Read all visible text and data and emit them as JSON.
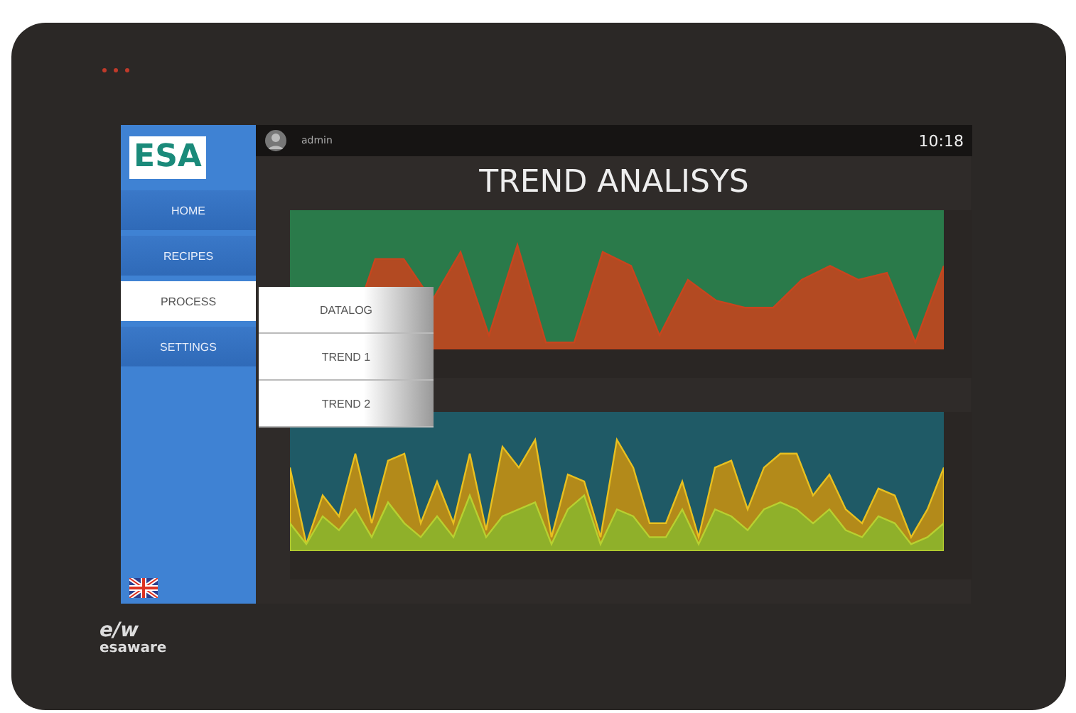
{
  "device": {
    "brand": "esaware",
    "brand_mark": "e/w"
  },
  "top_bar": {
    "user": "admin",
    "time": "10:18"
  },
  "sidebar": {
    "logo": "ESA",
    "items": [
      {
        "label": "HOME",
        "selected": false
      },
      {
        "label": "RECIPES",
        "selected": false
      },
      {
        "label": "PROCESS",
        "selected": true
      },
      {
        "label": "SETTINGS",
        "selected": false
      }
    ]
  },
  "submenu": {
    "items": [
      {
        "label": "DATALOG"
      },
      {
        "label": "TREND 1"
      },
      {
        "label": "TREND 2"
      }
    ]
  },
  "title": "TREND ANALISYS"
}
